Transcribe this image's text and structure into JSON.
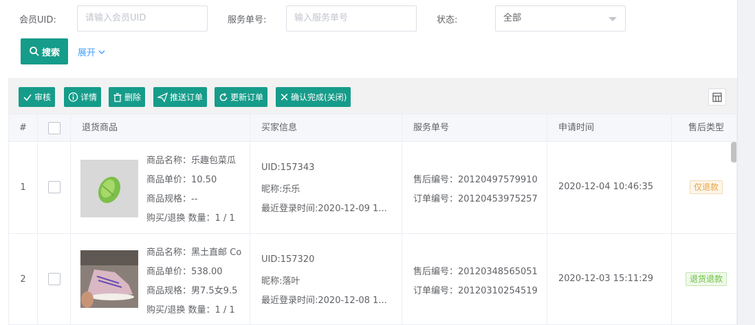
{
  "filters": {
    "uid_label": "会员UID:",
    "uid_placeholder": "请输入会员UID",
    "service_label": "服务单号:",
    "service_placeholder": "输入服务单号",
    "status_label": "状态:",
    "status_value": "全部"
  },
  "actions": {
    "search": "搜索",
    "expand": "展开"
  },
  "toolbar": [
    {
      "label": "审核",
      "icon": "check-icon"
    },
    {
      "label": "详情",
      "icon": "info-icon"
    },
    {
      "label": "删除",
      "icon": "trash-icon"
    },
    {
      "label": "推送订单",
      "icon": "send-icon"
    },
    {
      "label": "更新订单",
      "icon": "refresh-icon"
    },
    {
      "label": "确认完成(关闭)",
      "icon": "close-icon"
    }
  ],
  "columns": [
    "#",
    "",
    "退货商品",
    "买家信息",
    "服务单号",
    "申请时间",
    "售后类型"
  ],
  "rows": [
    {
      "index": "1",
      "product_name": "商品名称：乐趣包菜瓜",
      "product_price": "商品单价：10.50",
      "product_spec": "商品规格：--",
      "product_qty": "购买/退换 数量：1 / 1",
      "buyer_uid": "UID:157343",
      "buyer_nick": "昵称:乐乐",
      "buyer_login": "最近登录时间:2020-12-09 1...",
      "after_sale_no": "售后编号：20120497579910",
      "order_no": "订单编号：20120453975257",
      "apply_time": "2020-12-04 10:46:35",
      "type": "仅退款",
      "type_color": "#e6a23c"
    },
    {
      "index": "2",
      "product_name": "商品名称：黑土直邮 Co",
      "product_price": "商品单价：538.00",
      "product_spec": "商品规格：男7.5女9.5",
      "product_qty": "购买/退换 数量：1 / 1",
      "buyer_uid": "UID:157320",
      "buyer_nick": "昵称:落叶",
      "buyer_login": "最近登录时间:2020-12-08 1...",
      "after_sale_no": "售后编号：20120348565051",
      "order_no": "订单编号：20120310254519",
      "apply_time": "2020-12-03 15:11:29",
      "type": "退货退款",
      "type_color": "#67c23a"
    }
  ],
  "colors": {
    "primary": "#169c8a",
    "link": "#409eff"
  }
}
